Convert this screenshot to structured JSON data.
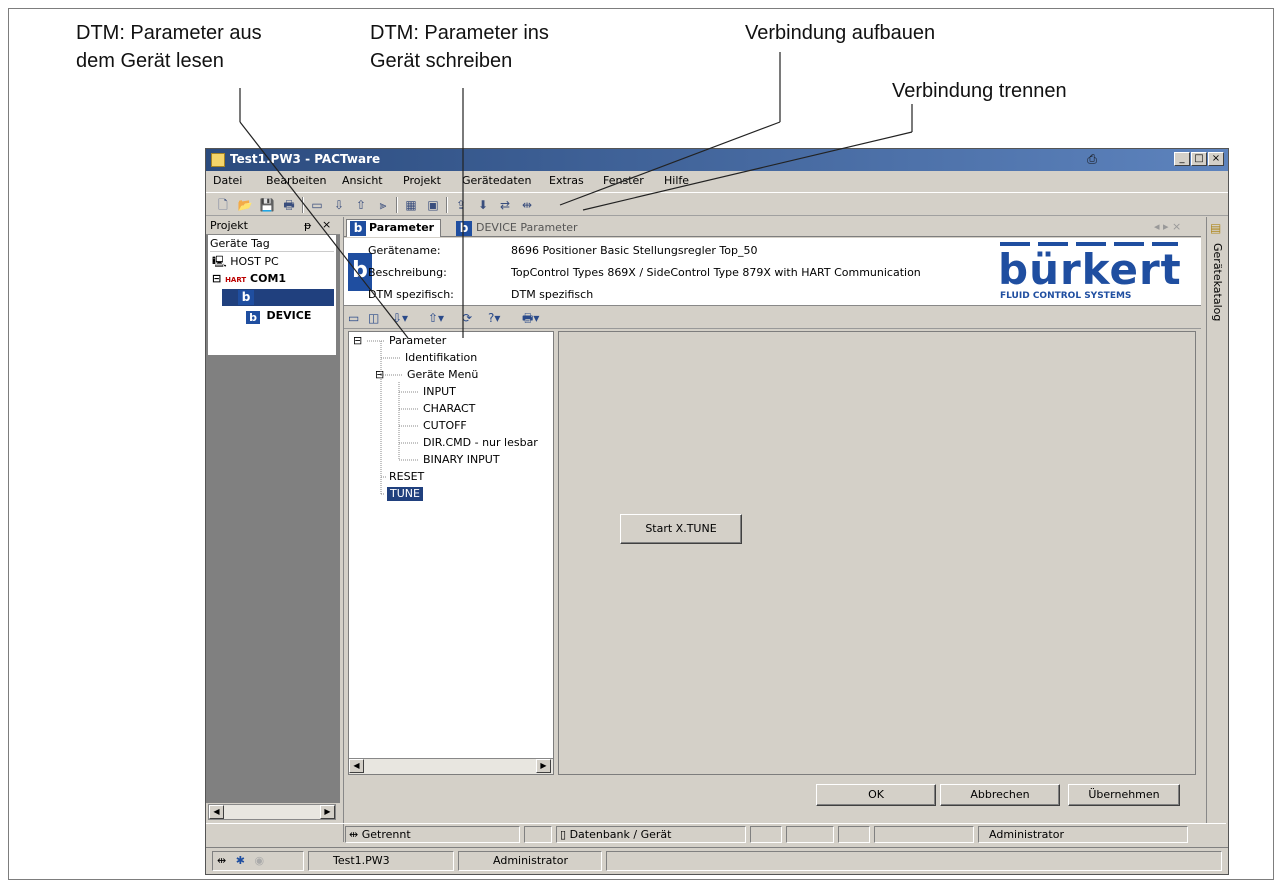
{
  "callouts": {
    "read_params_1": "DTM: Parameter aus",
    "read_params_2": "dem Gerät lesen",
    "write_params_1": "DTM: Parameter ins",
    "write_params_2": "Gerät schreiben",
    "connect": "Verbindung aufbauen",
    "disconnect": "Verbindung trennen"
  },
  "window": {
    "title": "Test1.PW3 - PACTware",
    "btn_min": "_",
    "btn_max": "□",
    "btn_close": "×"
  },
  "menu": [
    "Datei",
    "Bearbeiten",
    "Ansicht",
    "Projekt",
    "Gerätedaten",
    "Extras",
    "Fenster",
    "Hilfe"
  ],
  "project_pane": {
    "title": "Projekt",
    "pin": "ᵽ",
    "close": "×",
    "column": "Geräte Tag",
    "host": "HOST PC",
    "com": "COM1",
    "com_badge": "HART",
    "device": "DEVICE",
    "b_label": "b"
  },
  "tabs": {
    "active": "Parameter",
    "inactive": "DEVICE Parameter",
    "icon": "b",
    "nav": "◂ ▸ ×"
  },
  "header": {
    "name_label": "Gerätename:",
    "name_value": "8696 Positioner Basic Stellungsregler Top_50",
    "desc_label": "Beschreibung:",
    "desc_value": "TopControl Types 869X / SideControl Type 879X  with HART Communication",
    "dtm_label": "DTM spezifisch:",
    "dtm_value": "DTM spezifisch"
  },
  "logo": {
    "text": "bürkert",
    "sub": "FLUID CONTROL SYSTEMS"
  },
  "tree": {
    "root": "Parameter",
    "identifikation": "Identifikation",
    "menu": "Geräte Menü",
    "input": "INPUT",
    "charact": "CHARACT",
    "cutoff": "CUTOFF",
    "dircmd": "DIR.CMD - nur lesbar",
    "binary": "BINARY INPUT",
    "reset": "RESET",
    "tune": "TUNE"
  },
  "content": {
    "start_button": "Start X.TUNE"
  },
  "buttons": {
    "ok": "OK",
    "cancel": "Abbrechen",
    "apply": "Übernehmen"
  },
  "status": {
    "connection": "Getrennt",
    "source": "Datenbank / Gerät",
    "user": "Administrator"
  },
  "taskbar": {
    "file": "Test1.PW3",
    "user": "Administrator"
  },
  "right_dock": {
    "label": "Gerätekatalog"
  },
  "colors": {
    "accent": "#1f4ea0",
    "selection": "#20407e",
    "title_start": "#2b4b7e",
    "title_end": "#5d83bd"
  }
}
